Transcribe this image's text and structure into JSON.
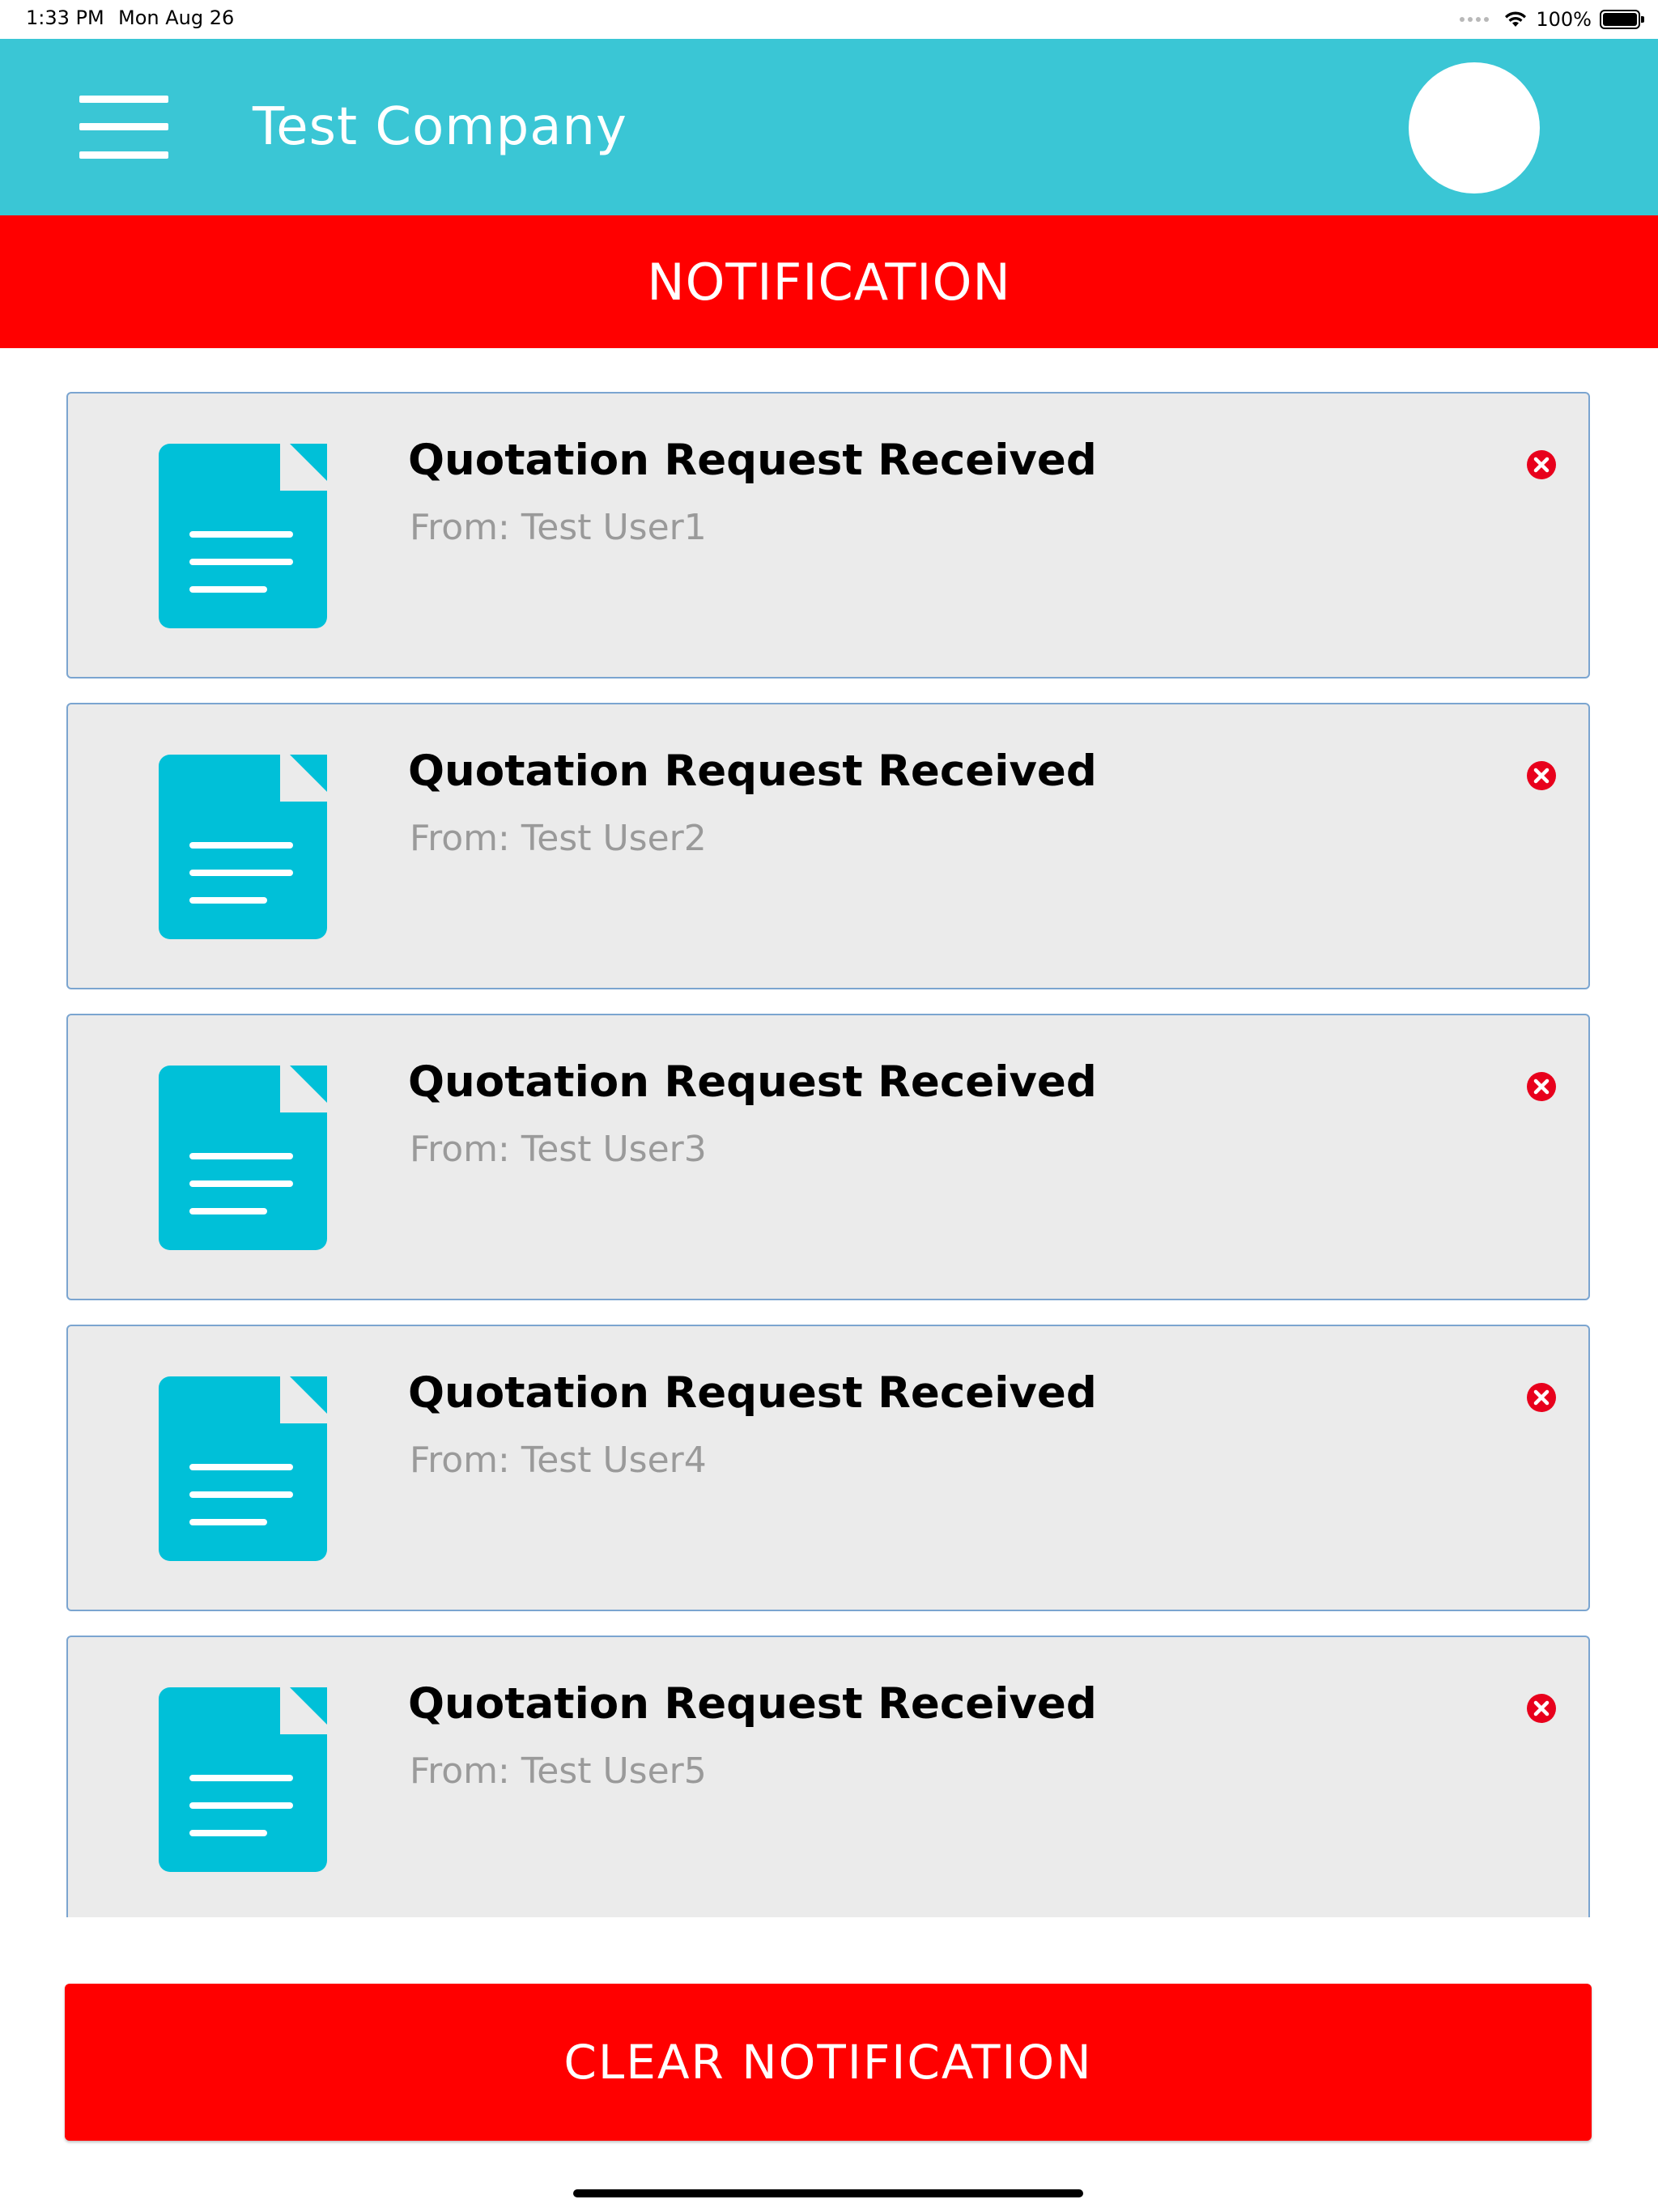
{
  "status_bar": {
    "time": "1:33 PM",
    "date": "Mon Aug 26",
    "battery": "100%"
  },
  "header": {
    "title": "Test Company",
    "color": "#3AC6D5"
  },
  "section": {
    "title": "NOTIFICATION",
    "color": "#FF0000"
  },
  "notifications": [
    {
      "title": "Quotation Request Received",
      "subtitle": "From: Test User1"
    },
    {
      "title": "Quotation Request Received",
      "subtitle": "From: Test User2"
    },
    {
      "title": "Quotation Request Received",
      "subtitle": "From: Test User3"
    },
    {
      "title": "Quotation Request Received",
      "subtitle": "From: Test User4"
    },
    {
      "title": "Quotation Request Received",
      "subtitle": "From: Test User5"
    }
  ],
  "icons": {
    "menu": "hamburger-menu-icon",
    "avatar": "avatar",
    "document": "document-icon",
    "close": "close-circle-icon"
  },
  "footer": {
    "clear_label": "CLEAR NOTIFICATION"
  },
  "colors": {
    "accent": "#00C0D8",
    "danger": "#FF0000",
    "card_bg": "#EBEBEB",
    "card_border": "#7BA5D0"
  }
}
